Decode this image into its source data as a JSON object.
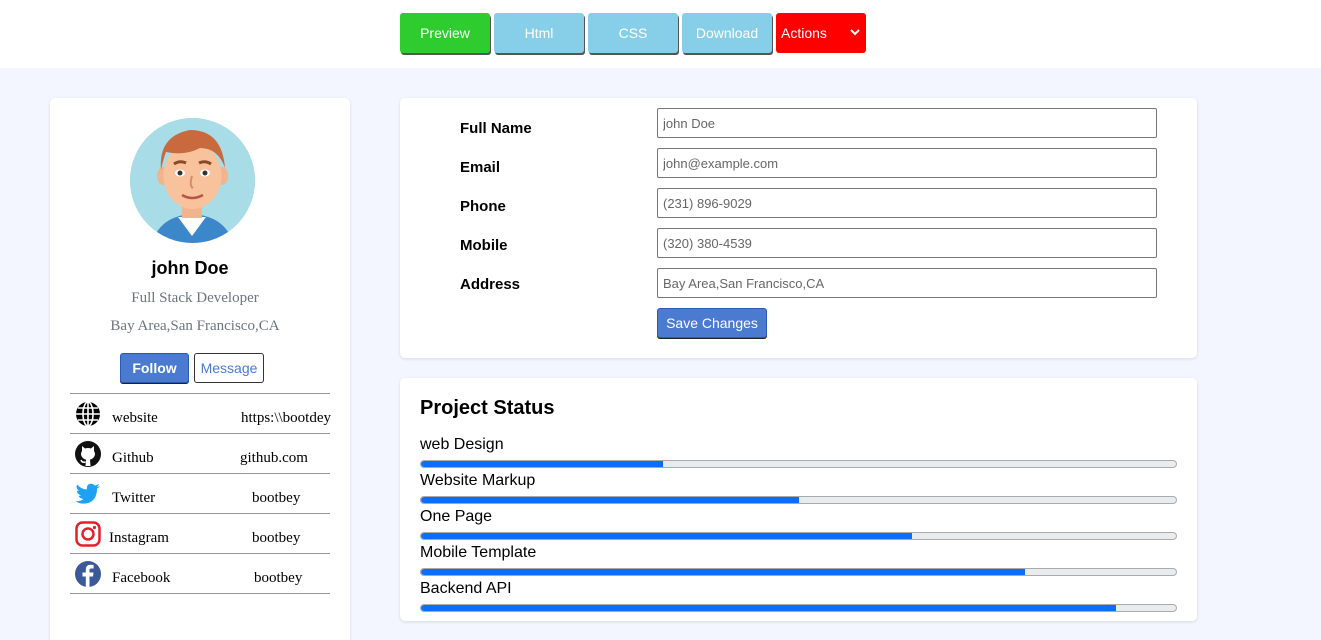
{
  "toolbar": {
    "preview_label": "Preview",
    "html_label": "Html",
    "css_label": "CSS",
    "download_label": "Download",
    "actions_label": "Actions"
  },
  "profile": {
    "name": "john Doe",
    "role": "Full Stack Developer",
    "location": "Bay Area,San Francisco,CA",
    "follow_label": "Follow",
    "message_label": "Message",
    "social": [
      {
        "icon": "globe-icon",
        "label": "website",
        "value": "https:\\\\bootdey"
      },
      {
        "icon": "github-icon",
        "label": "Github",
        "value": "github.com"
      },
      {
        "icon": "twitter-icon",
        "label": "Twitter",
        "value": "bootbey"
      },
      {
        "icon": "instagram-icon",
        "label": "Instagram",
        "value": "bootbey"
      },
      {
        "icon": "facebook-icon",
        "label": "Facebook",
        "value": "bootbey"
      }
    ]
  },
  "form": {
    "fields": [
      {
        "label": "Full Name",
        "value": "john Doe"
      },
      {
        "label": "Email",
        "value": "john@example.com"
      },
      {
        "label": "Phone",
        "value": "(231) 896-9029"
      },
      {
        "label": "Mobile",
        "value": "(320) 380-4539"
      },
      {
        "label": "Address",
        "value": "Bay Area,San Francisco,CA"
      }
    ],
    "save_label": "Save Changes"
  },
  "project_status": {
    "title": "Project Status",
    "items": [
      {
        "label": "web Design",
        "progress": 32
      },
      {
        "label": "Website Markup",
        "progress": 50
      },
      {
        "label": "One Page",
        "progress": 65
      },
      {
        "label": "Mobile Template",
        "progress": 80
      },
      {
        "label": "Backend API",
        "progress": 92
      }
    ]
  },
  "colors": {
    "preview": "#2ecc2e",
    "secondary_toolbar": "#87cee8",
    "actions": "#ff0000",
    "primary": "#4a7bd0",
    "progress": "#0d6efd",
    "background": "#f4f6ff"
  }
}
